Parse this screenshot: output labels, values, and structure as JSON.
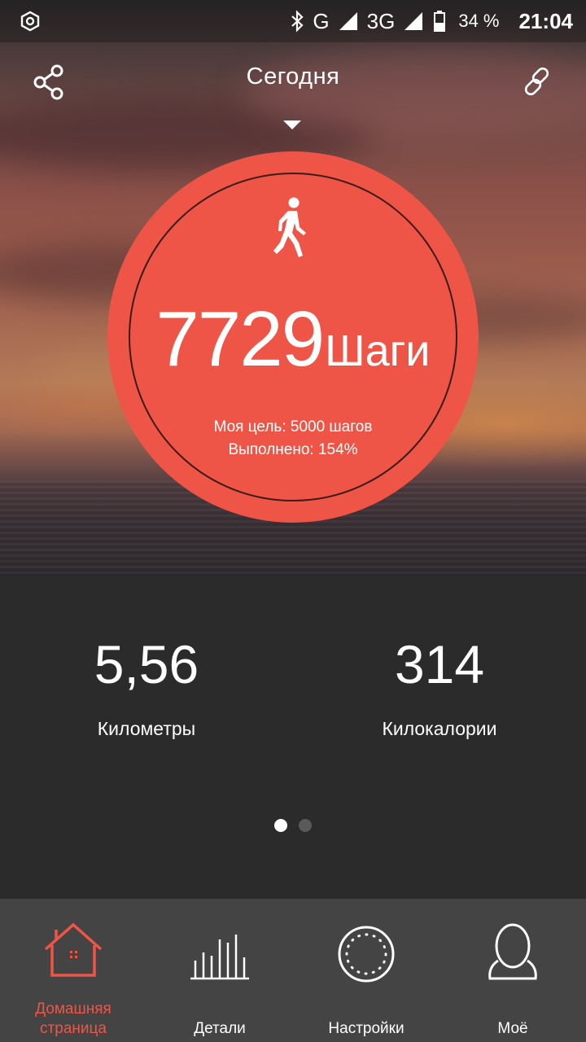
{
  "status_bar": {
    "network_g": "G",
    "network_3g": "3G",
    "battery_percent": "34 %",
    "time": "21:04"
  },
  "header": {
    "title": "Сегодня"
  },
  "steps": {
    "value": "7729",
    "unit": "Шаги",
    "goal_text": "Моя цель: 5000 шагов",
    "completed_text": "Выполнено: 154%"
  },
  "stats": {
    "distance": {
      "value": "5,56",
      "label": "Километры"
    },
    "calories": {
      "value": "314",
      "label": "Килокалории"
    }
  },
  "pager": {
    "pages": 2,
    "active_index": 0
  },
  "bottom_nav": {
    "items": [
      {
        "label": "Домашняя страница",
        "icon": "home-icon",
        "active": true
      },
      {
        "label": "Детали",
        "icon": "bar-chart-icon",
        "active": false
      },
      {
        "label": "Настройки",
        "icon": "settings-ring-icon",
        "active": false
      },
      {
        "label": "Моё",
        "icon": "profile-icon",
        "active": false
      }
    ]
  },
  "colors": {
    "accent": "#ef5546",
    "panel_bg": "#2b2b2b",
    "nav_bg": "#444444"
  }
}
